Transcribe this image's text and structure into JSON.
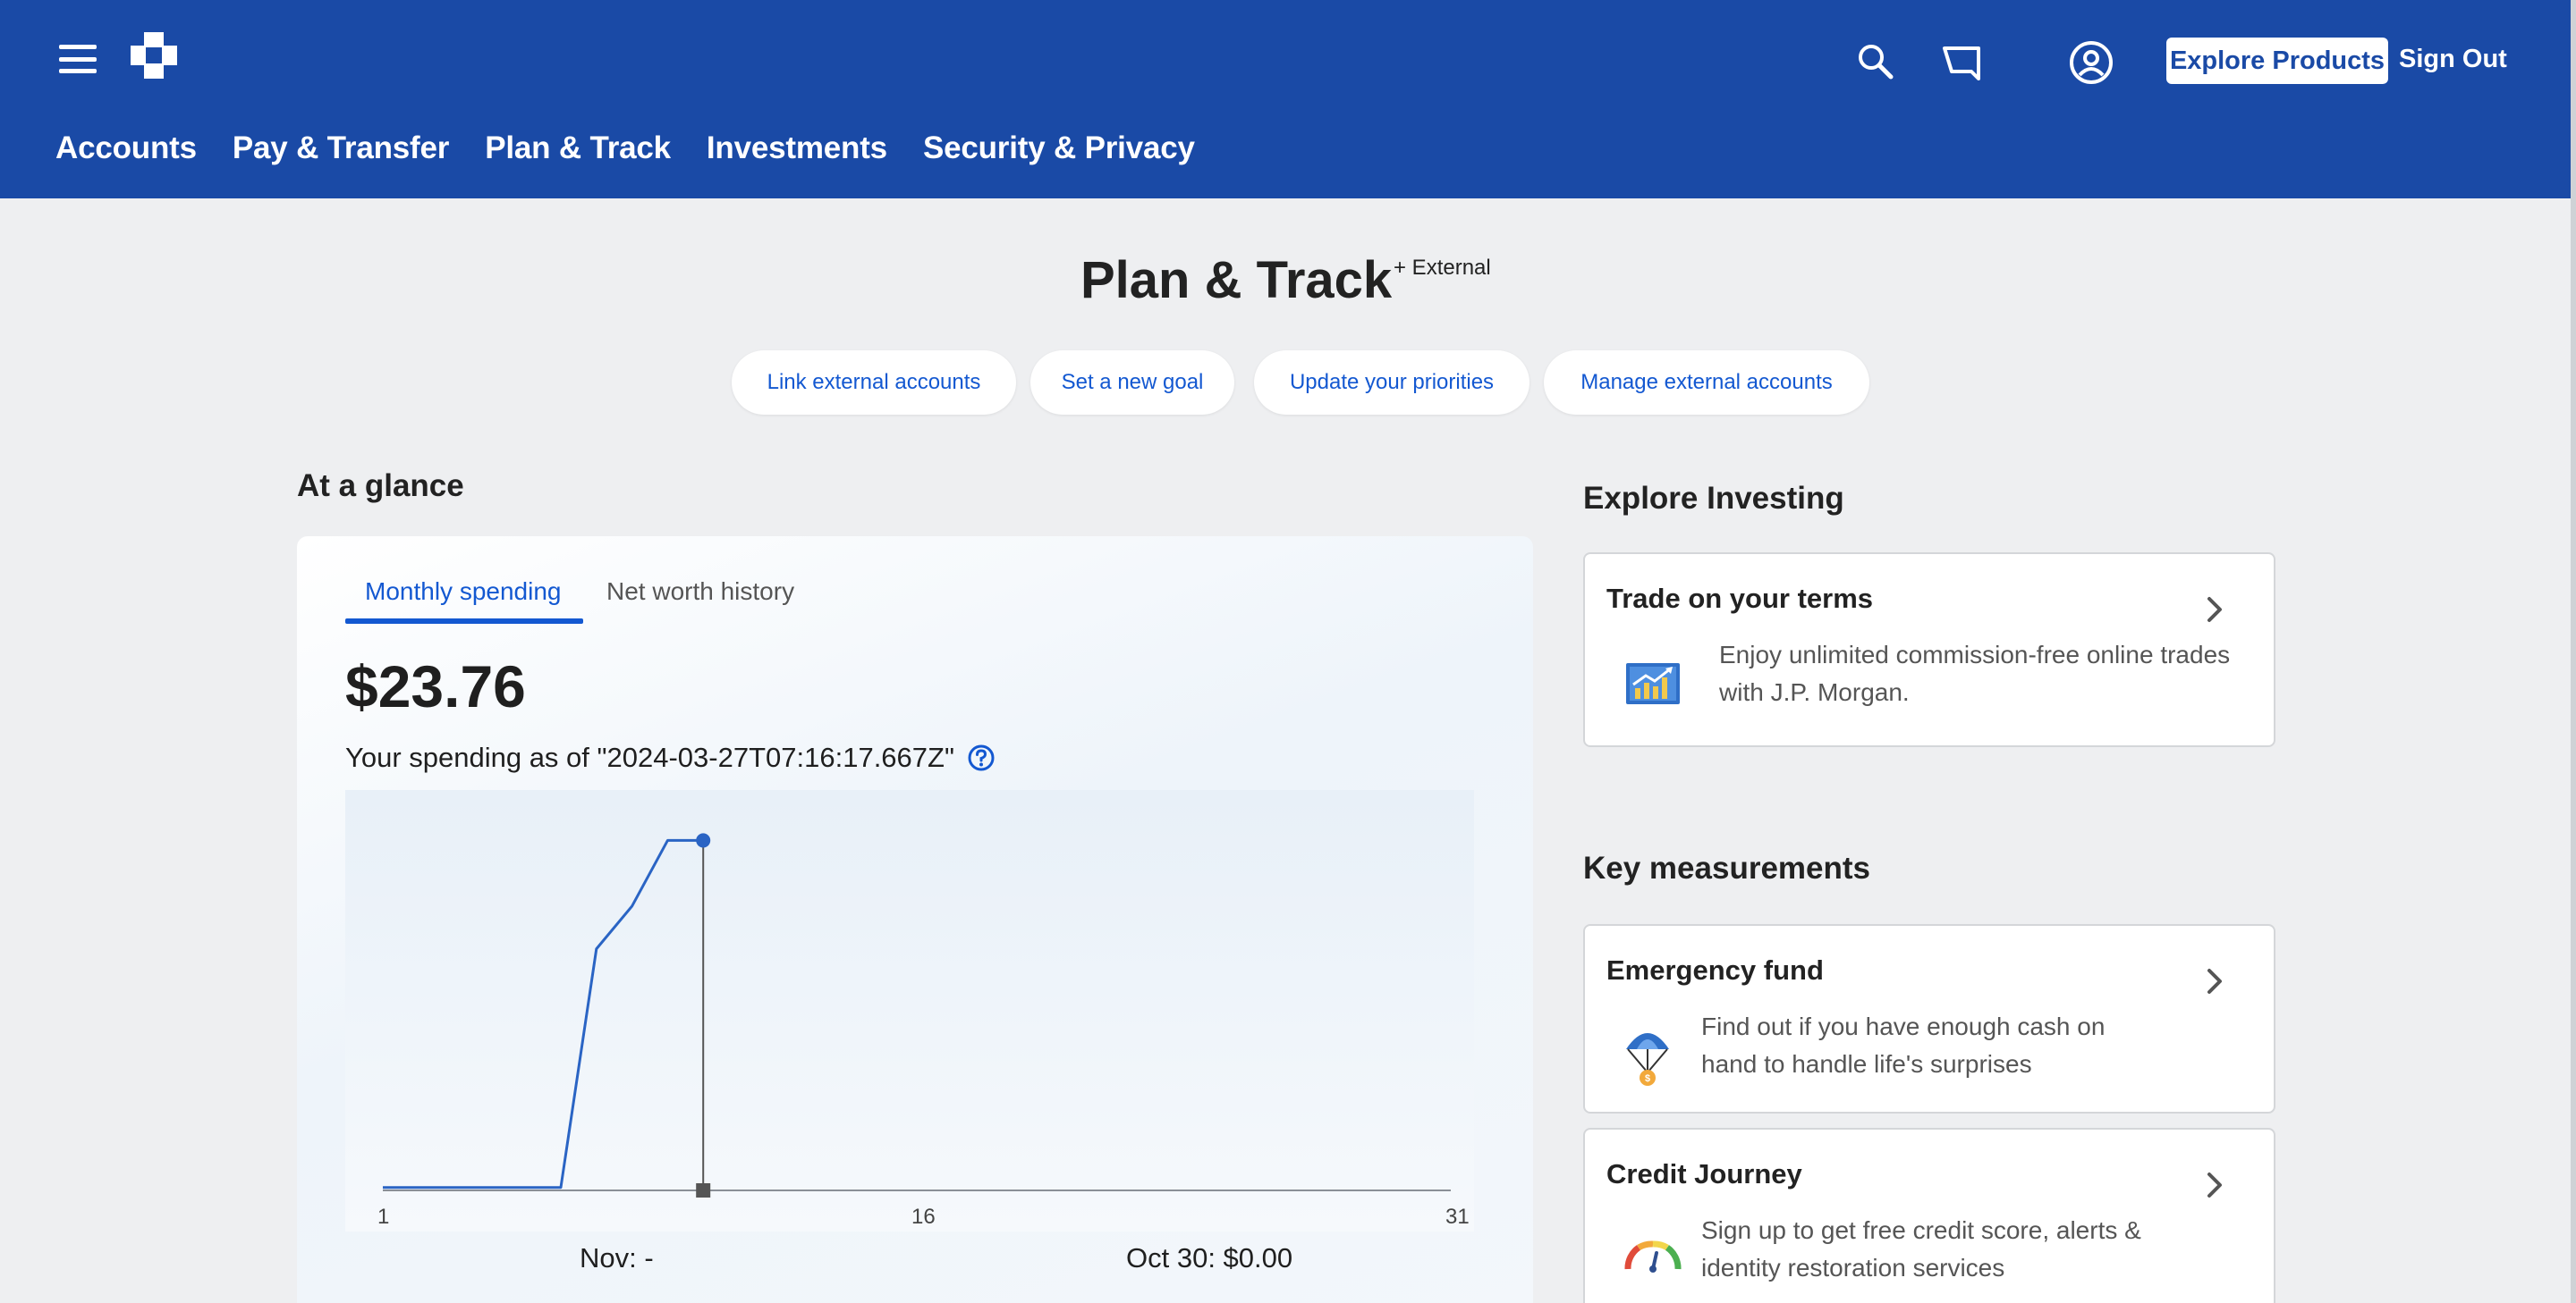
{
  "header": {
    "nav": [
      "Accounts",
      "Pay & Transfer",
      "Plan & Track",
      "Investments",
      "Security & Privacy"
    ],
    "explore_label": "Explore Products",
    "signout_label": "Sign Out",
    "icons": [
      "menu-icon",
      "chase-logo",
      "search-icon",
      "messages-icon",
      "profile-icon"
    ],
    "brand_color": "#1a4aa6"
  },
  "page": {
    "title": "Plan & Track",
    "title_badge": "+ External",
    "actions": [
      "Link external accounts",
      "Set a new goal",
      "Update your priorities",
      "Manage external accounts"
    ]
  },
  "glance": {
    "heading": "At a glance",
    "tabs": [
      "Monthly spending",
      "Net worth history"
    ],
    "active_tab": "Monthly spending",
    "amount": "$23.76",
    "asof": "Your spending as of \"2024-03-27T07:16:17.667Z\"",
    "x_ticks": [
      "1",
      "16",
      "31"
    ],
    "summary_left": "Nov: -",
    "summary_right": "Oct 30: $0.00",
    "line_color": "#2a64c4"
  },
  "chart_data": {
    "type": "line",
    "x": [
      1,
      2,
      3,
      4,
      5,
      6,
      7,
      8,
      9,
      10
    ],
    "series": [
      {
        "values": [
          0.2,
          0.2,
          0.2,
          0.2,
          0.2,
          0.2,
          16.4,
          19.3,
          23.76,
          23.76
        ]
      }
    ],
    "xlim": [
      1,
      31
    ],
    "ylim": [
      0,
      25
    ],
    "x_ticks": [
      "1",
      "16",
      "31"
    ],
    "marker_day": 10
  },
  "explore": {
    "heading": "Explore Investing",
    "card": {
      "title": "Trade on your terms",
      "desc_line1": "Enjoy unlimited commission-free online trades",
      "desc_line2": "with J.P. Morgan.",
      "icon": "trading-chart-icon"
    }
  },
  "measurements": {
    "heading": "Key measurements",
    "cards": [
      {
        "title": "Emergency fund",
        "desc_line1": "Find out if you have enough cash on",
        "desc_line2": "hand to handle life's surprises",
        "icon": "parachute-icon"
      },
      {
        "title": "Credit Journey",
        "desc_line1": "Sign up to get free credit score, alerts &",
        "desc_line2": "identity restoration services",
        "icon": "credit-gauge-icon"
      }
    ]
  }
}
